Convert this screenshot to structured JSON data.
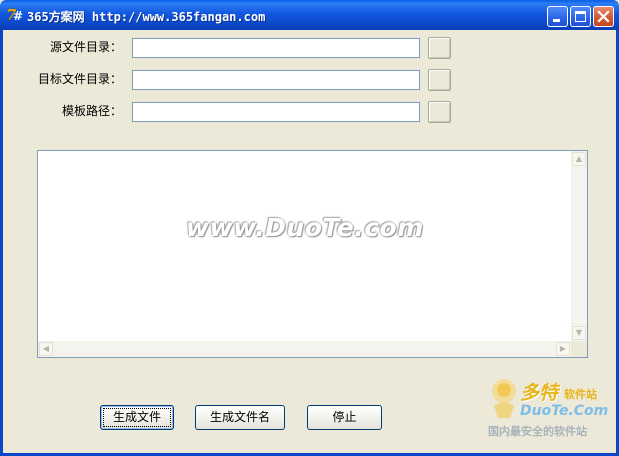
{
  "window": {
    "title": "365方案网 http://www.365fangan.com",
    "accent": "#0A5FE6"
  },
  "form": {
    "source_dir_label": "源文件目录：",
    "source_dir_value": "",
    "target_dir_label": "目标文件目录：",
    "target_dir_value": "",
    "template_path_label": "模板路径：",
    "template_path_value": ""
  },
  "log": {
    "watermark": "www.DuoTe.com"
  },
  "buttons": {
    "generate_file": "生成文件",
    "generate_filename": "生成文件名",
    "stop": "停止"
  },
  "logo": {
    "big": "多特",
    "small": "软件站",
    "brand": "DuoTe.Com",
    "tagline": "国内最安全的软件站"
  }
}
